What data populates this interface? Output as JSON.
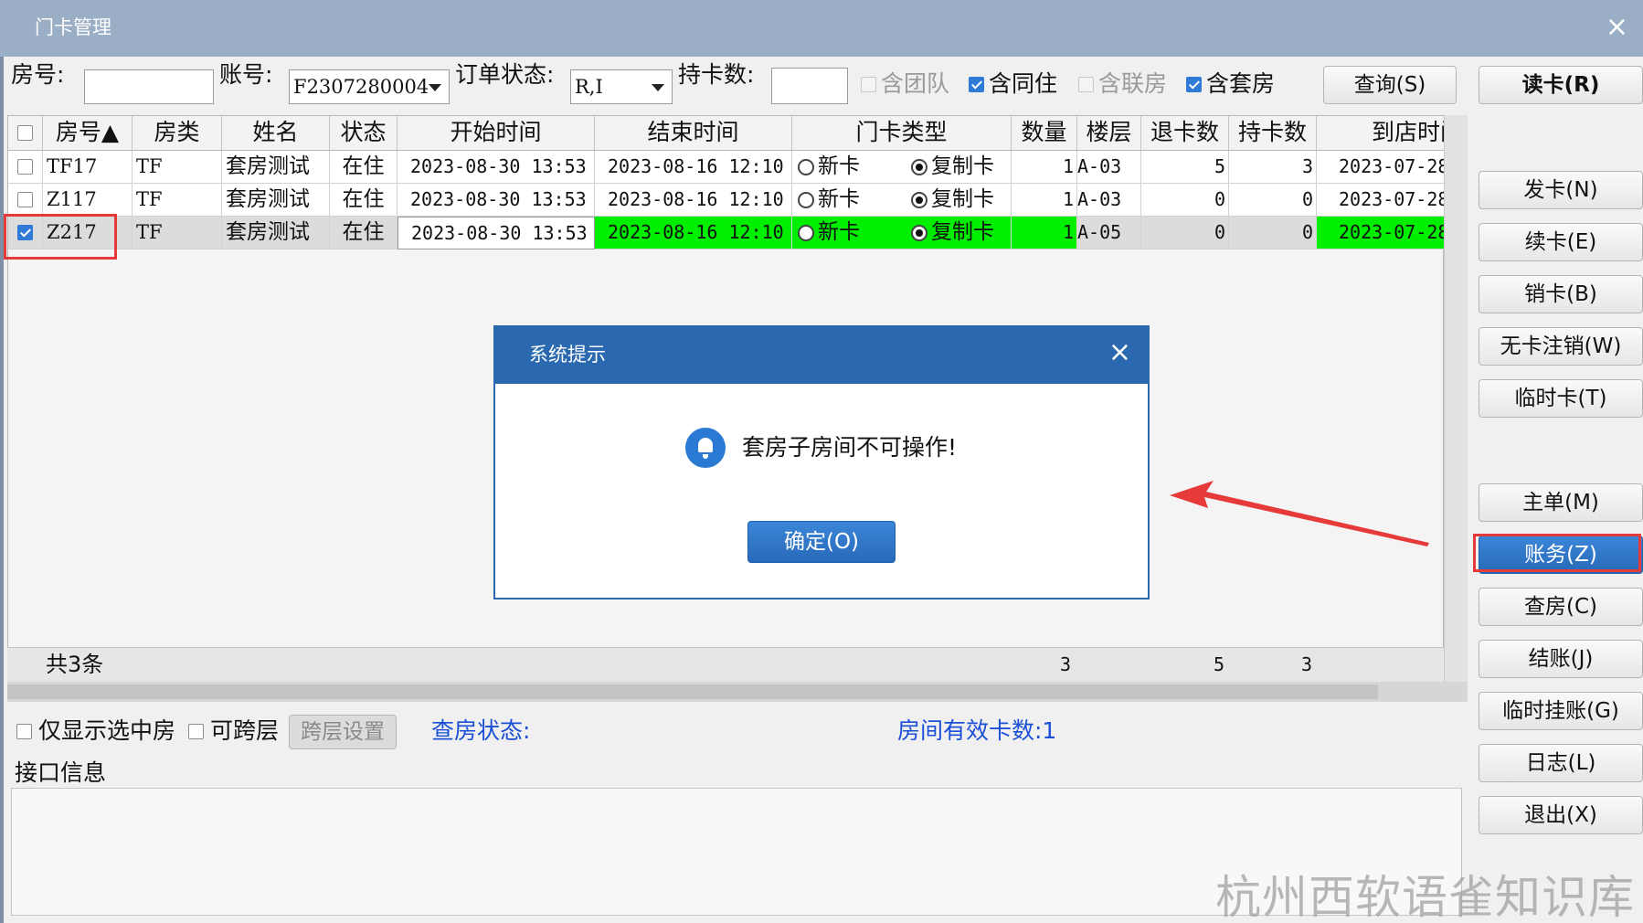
{
  "window": {
    "title": "门卡管理",
    "close_glyph": "×"
  },
  "toolbar": {
    "room_label": "房号:",
    "room_value": "",
    "account_label": "账号:",
    "account_value": "F2307280004",
    "order_status_label": "订单状态:",
    "order_status_value": "R,I",
    "card_count_label": "持卡数:",
    "card_count_value": "",
    "checkboxes": [
      {
        "label": "含团队",
        "checked": false,
        "disabled": true
      },
      {
        "label": "含同住",
        "checked": true,
        "disabled": false
      },
      {
        "label": "含联房",
        "checked": false,
        "disabled": true
      },
      {
        "label": "含套房",
        "checked": true,
        "disabled": false
      }
    ],
    "query_button": "查询(S)"
  },
  "side_buttons": {
    "read_card": "读卡(R)",
    "issue": "发卡(N)",
    "renew": "续卡(E)",
    "cancel": "销卡(B)",
    "no_card_cancel": "无卡注销(W)",
    "temp_card": "临时卡(T)",
    "main_bill": "主单(M)",
    "account": "账务(Z)",
    "check_room": "查房(C)",
    "checkout": "结账(J)",
    "temp_hold": "临时挂账(G)",
    "log": "日志(L)",
    "exit": "退出(X)"
  },
  "table": {
    "headers": [
      "房号▲",
      "房类",
      "姓名",
      "状态",
      "开始时间",
      "结束时间",
      "门卡类型",
      "数量",
      "楼层",
      "退卡数",
      "持卡数",
      "到店时间"
    ],
    "rows": [
      {
        "checked": false,
        "room": "TF17",
        "type": "TF",
        "name": "套房测试",
        "status": "在住",
        "start": "2023-08-30 13:53",
        "end": "2023-08-16 12:10",
        "card_new": "新卡",
        "card_copy": "复制卡",
        "qty": "1",
        "floor": "A-03",
        "returned": "5",
        "held": "3",
        "arrival": "2023-07-28"
      },
      {
        "checked": false,
        "room": "Z117",
        "type": "TF",
        "name": "套房测试",
        "status": "在住",
        "start": "2023-08-30 13:53",
        "end": "2023-08-16 12:10",
        "card_new": "新卡",
        "card_copy": "复制卡",
        "qty": "1",
        "floor": "A-03",
        "returned": "0",
        "held": "0",
        "arrival": "2023-07-28"
      },
      {
        "checked": true,
        "room": "Z217",
        "type": "TF",
        "name": "套房测试",
        "status": "在住",
        "start": "2023-08-30 13:53",
        "end": "2023-08-16 12:10",
        "card_new": "新卡",
        "card_copy": "复制卡",
        "qty": "1",
        "floor": "A-05",
        "returned": "0",
        "held": "0",
        "arrival": "2023-07-28"
      }
    ],
    "footer": {
      "total": "共3条",
      "qty_sum": "3",
      "returned_sum": "5",
      "held_sum": "3"
    }
  },
  "bottom": {
    "only_selected": "仅显示选中房",
    "cross_floor": "可跨层",
    "cross_floor_settings": "跨层设置",
    "check_status": "查房状态:",
    "valid_cards": "房间有效卡数:1",
    "interface_info": "接口信息"
  },
  "dialog": {
    "title": "系统提示",
    "message": "套房子房间不可操作!",
    "ok": "确定(O)",
    "close_glyph": "×"
  },
  "watermark": "杭州西软语雀知识库",
  "colors": {
    "titlebar": "#9aaec6",
    "dialog": "#2a69b0",
    "highlight": "#00ee00",
    "annotation": "#e63a3a",
    "link": "#1a4fd6"
  }
}
